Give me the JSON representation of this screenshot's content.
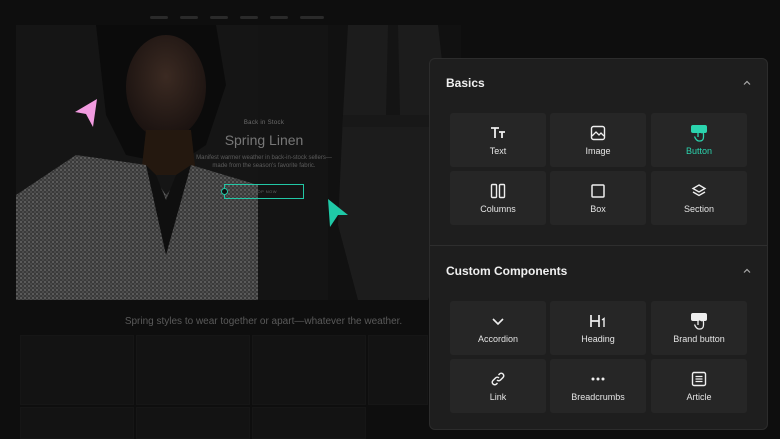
{
  "page": {
    "eyebrow": "Back in Stock",
    "headline": "Spring Linen",
    "description": "Manifest warmer weather in back-in-stock sellers—made from the season's favorite fabric.",
    "shop_button": "SHOP NOW",
    "tagline": "Spring styles to wear together or apart—whatever the weather."
  },
  "panel": {
    "basics": {
      "title": "Basics",
      "items": [
        {
          "label": "Text",
          "icon": "text-icon"
        },
        {
          "label": "Image",
          "icon": "image-icon"
        },
        {
          "label": "Button",
          "icon": "button-icon",
          "active": true
        },
        {
          "label": "Columns",
          "icon": "columns-icon"
        },
        {
          "label": "Box",
          "icon": "box-icon"
        },
        {
          "label": "Section",
          "icon": "section-icon"
        }
      ]
    },
    "custom": {
      "title": "Custom Components",
      "items": [
        {
          "label": "Accordion",
          "icon": "chevron-down-icon"
        },
        {
          "label": "Heading",
          "icon": "heading-icon"
        },
        {
          "label": "Brand button",
          "icon": "brand-button-icon"
        },
        {
          "label": "Link",
          "icon": "link-icon"
        },
        {
          "label": "Breadcrumbs",
          "icon": "more-dots-icon"
        },
        {
          "label": "Article",
          "icon": "article-icon"
        }
      ]
    }
  },
  "colors": {
    "accent": "#2bd4ae",
    "cursor_teal": "#1fc9a7",
    "cursor_pink": "#f29be0",
    "panel_bg": "#1e1e1e",
    "tile_bg": "#262626"
  }
}
